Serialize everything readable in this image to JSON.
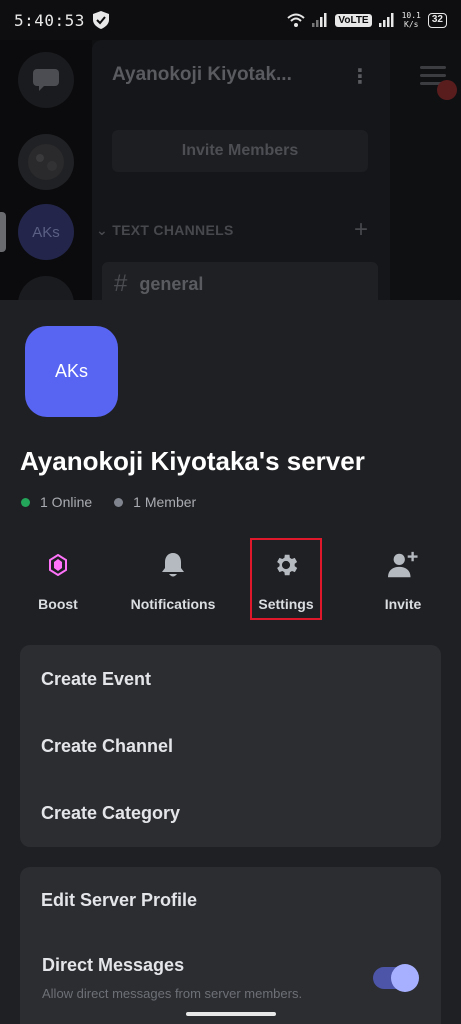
{
  "status_bar": {
    "time": "5:40:53",
    "volte": "VoLTE",
    "speed_value": "10.1",
    "speed_unit": "K/s",
    "battery": "32"
  },
  "background_app": {
    "rail_avatar_label": "AKs",
    "server_title": "Ayanokoji Kiyotak...",
    "invite_button": "Invite Members",
    "section_header": "TEXT CHANNELS",
    "channel_hash": "#",
    "channel_name": "general"
  },
  "sheet": {
    "server_icon_text": "AKs",
    "server_name": "Ayanokoji Kiyotaka's server",
    "online_count": "1 Online",
    "member_count": "1 Member",
    "actions": {
      "boost": "Boost",
      "notifications": "Notifications",
      "settings": "Settings",
      "invite": "Invite"
    },
    "menu_group_1": [
      "Create Event",
      "Create Channel",
      "Create Category"
    ],
    "menu_group_2": {
      "edit_profile": "Edit Server Profile",
      "dm_title": "Direct Messages",
      "dm_subtitle": "Allow direct messages from server members.",
      "dm_enabled": true
    }
  },
  "colors": {
    "accent": "#5865f2",
    "online": "#23a55a",
    "highlight_box": "#e0182c",
    "boost": "#ff73fa"
  }
}
